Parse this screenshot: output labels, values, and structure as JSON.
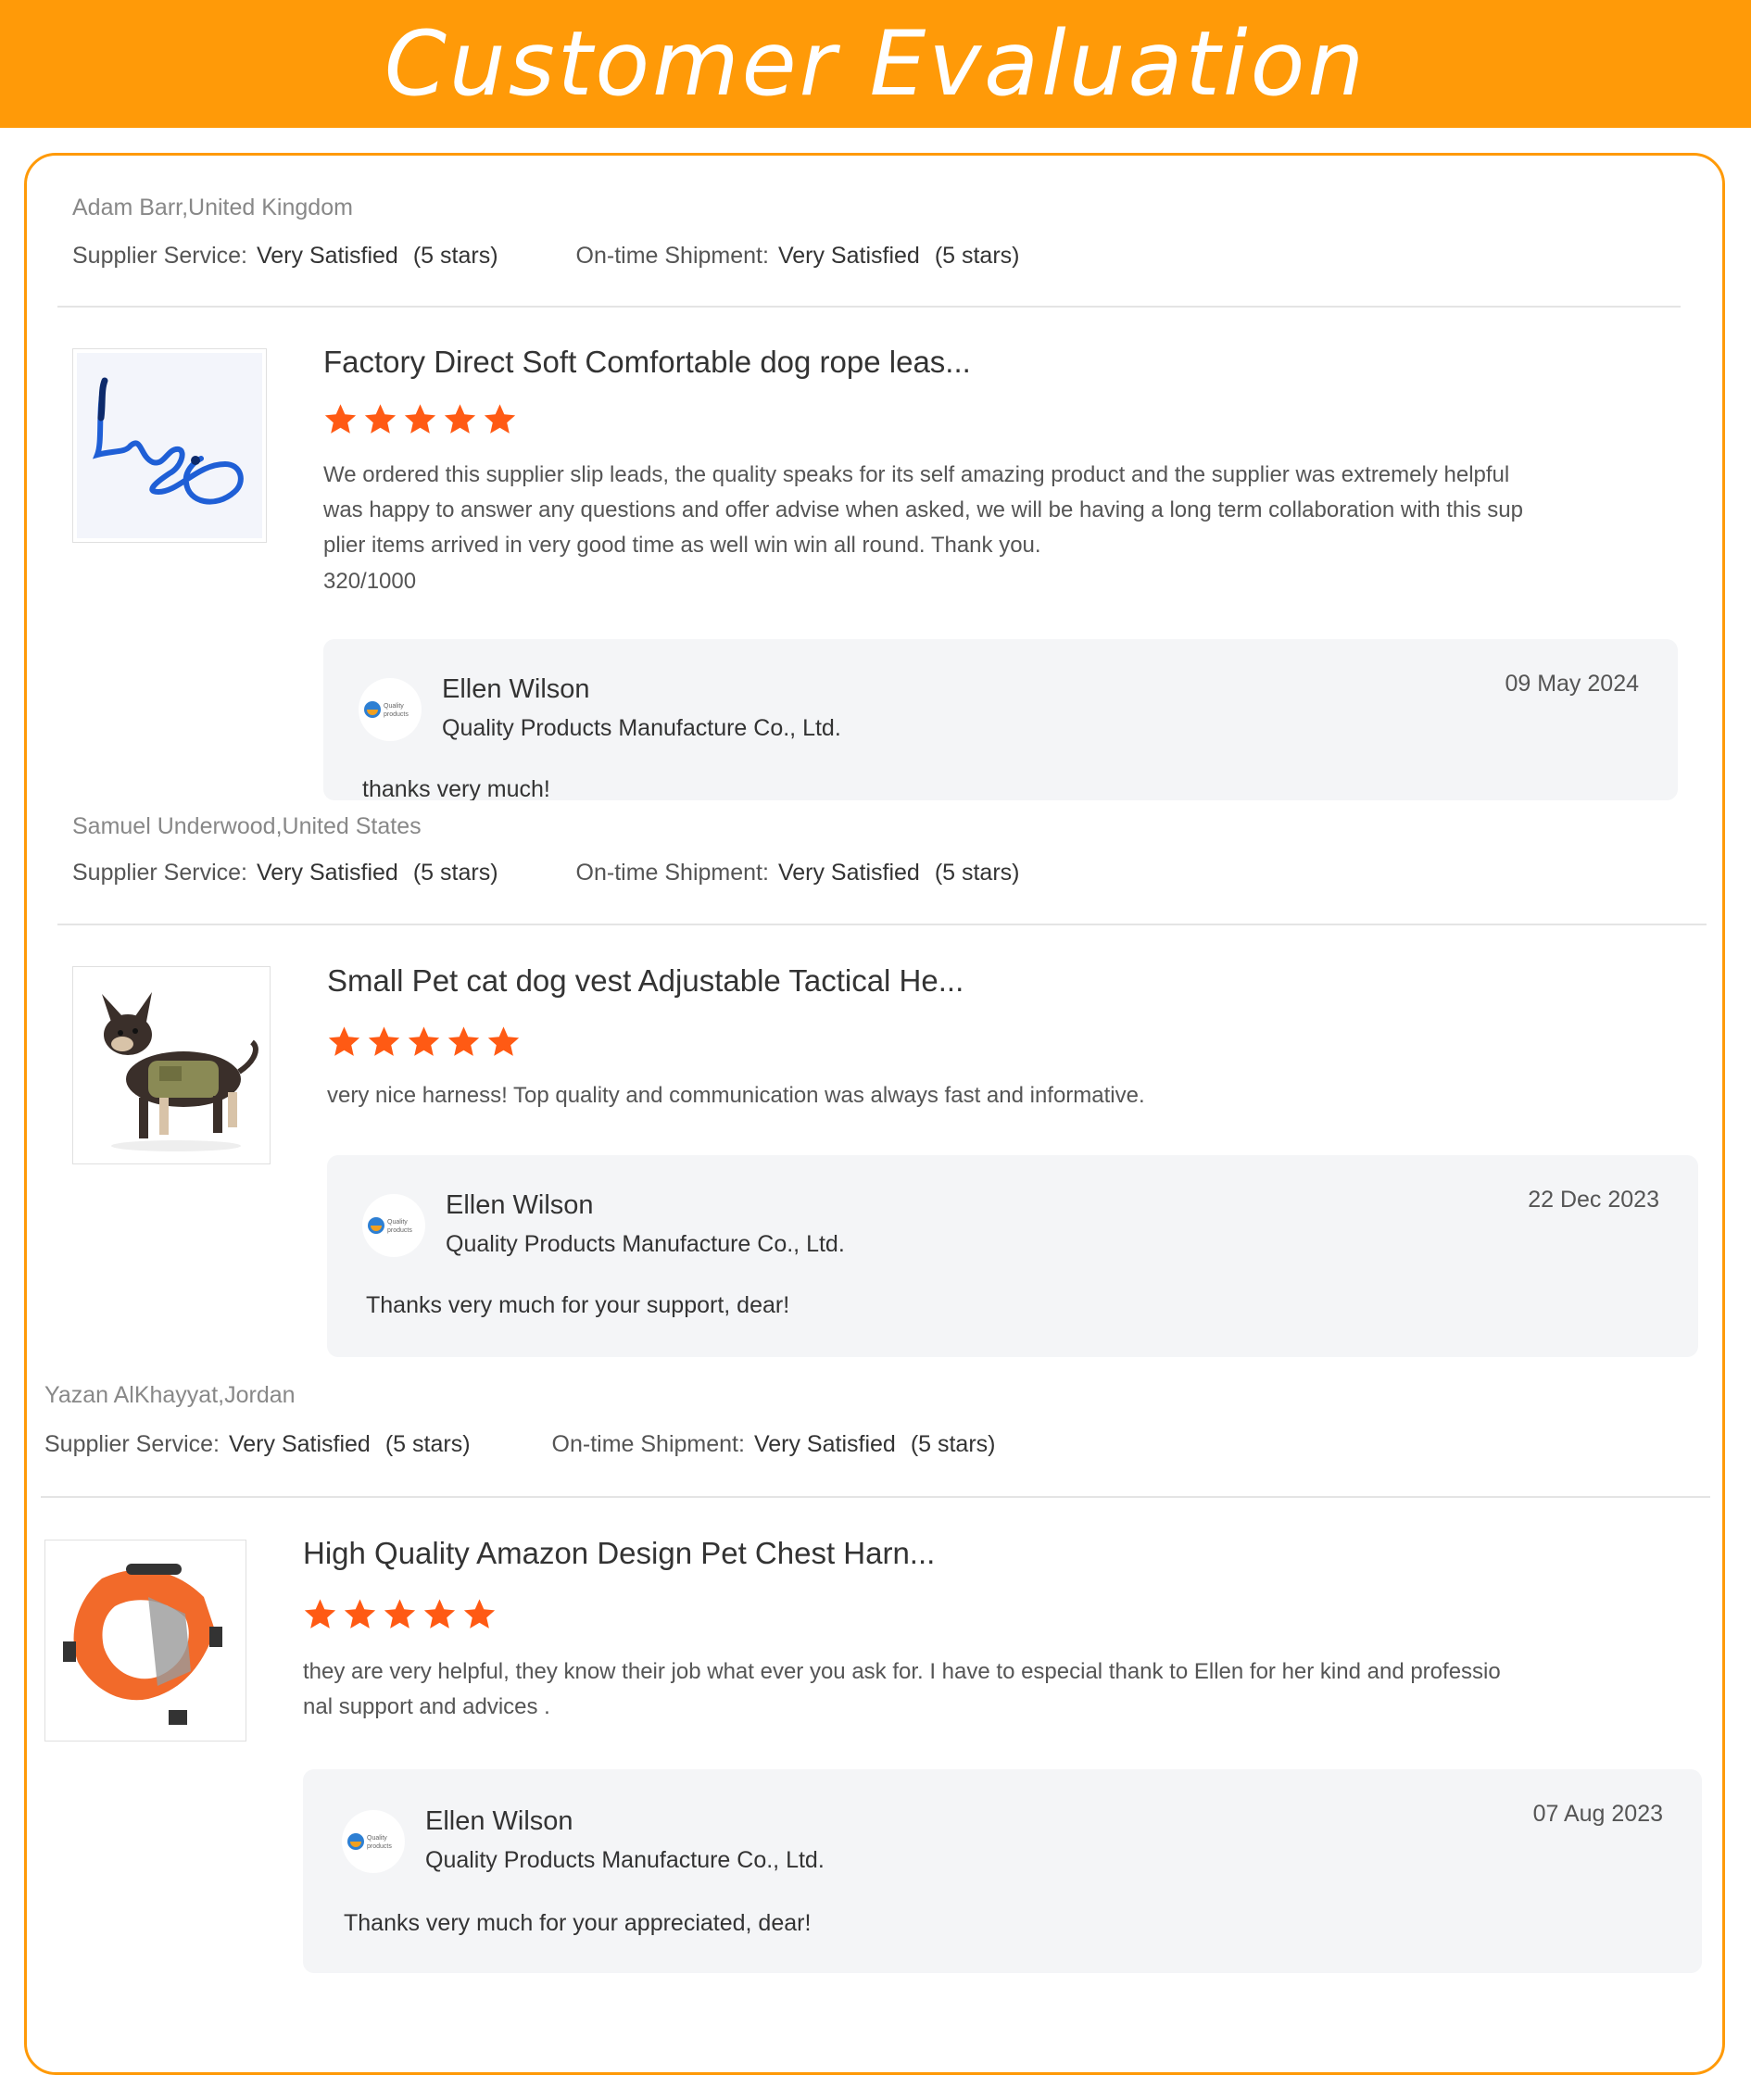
{
  "header": {
    "title": "Customer Evaluation"
  },
  "colors": {
    "banner": "#ff9a08",
    "star": "#ff5a14",
    "reply_bg": "#f4f5f7"
  },
  "reviews": [
    {
      "reviewer": "Adam Barr,United Kingdom",
      "supplier_service": {
        "label": "Supplier Service:",
        "value": "Very Satisfied",
        "count": "(5 stars)"
      },
      "shipment": {
        "label": "On-time Shipment:",
        "value": "Very Satisfied",
        "count": "(5 stars)"
      },
      "product_image": "blue-dog-rope-leash",
      "product_title": "Factory Direct Soft Comfortable dog rope leas...",
      "stars": 5,
      "text": "We ordered this supplier slip leads, the quality speaks for its self amazing product and the supplier was extremely helpful was happy to answer any questions and offer advise when asked, we will be having a long term collaboration with this supplier items arrived in very good time as well win win all round. Thank you.",
      "text_lines": [
        "We ordered this supplier slip leads, the quality speaks for its self amazing product and the supplier was extremely helpful",
        "was happy to answer any questions and offer advise when asked, we will be having a long term collaboration with this sup",
        "plier items arrived in very good time as well win win all round. Thank you."
      ],
      "char_count": "320/1000",
      "reply": {
        "name": "Ellen Wilson",
        "company": "Quality Products Manufacture Co., Ltd.",
        "date": "09 May 2024",
        "text": "thanks very much!"
      }
    },
    {
      "reviewer": "Samuel Underwood,United States",
      "supplier_service": {
        "label": "Supplier Service:",
        "value": "Very Satisfied",
        "count": "(5 stars)"
      },
      "shipment": {
        "label": "On-time Shipment:",
        "value": "Very Satisfied",
        "count": "(5 stars)"
      },
      "product_image": "chihuahua-in-tactical-vest",
      "product_title": "Small Pet cat dog vest Adjustable Tactical He...",
      "stars": 5,
      "text_lines": [
        "very nice harness! Top quality and communication was always fast and informative."
      ],
      "reply": {
        "name": "Ellen Wilson",
        "company": "Quality Products Manufacture Co., Ltd.",
        "date": "22 Dec 2023",
        "text": "Thanks very much for your support, dear!"
      }
    },
    {
      "reviewer": "Yazan AlKhayyat,Jordan",
      "supplier_service": {
        "label": "Supplier Service:",
        "value": "Very Satisfied",
        "count": "(5 stars)"
      },
      "shipment": {
        "label": "On-time Shipment:",
        "value": "Very Satisfied",
        "count": "(5 stars)"
      },
      "product_image": "orange-pet-chest-harness",
      "product_title": "High Quality Amazon Design Pet Chest Harn...",
      "stars": 5,
      "text_lines": [
        "they are very helpful, they know their job what ever you ask for. I have to especial thank to Ellen for her kind and professio",
        "nal support and advices ."
      ],
      "reply": {
        "name": "Ellen Wilson",
        "company": "Quality Products Manufacture Co., Ltd.",
        "date": "07 Aug 2023",
        "text": "Thanks very much for your appreciated, dear!"
      }
    }
  ]
}
